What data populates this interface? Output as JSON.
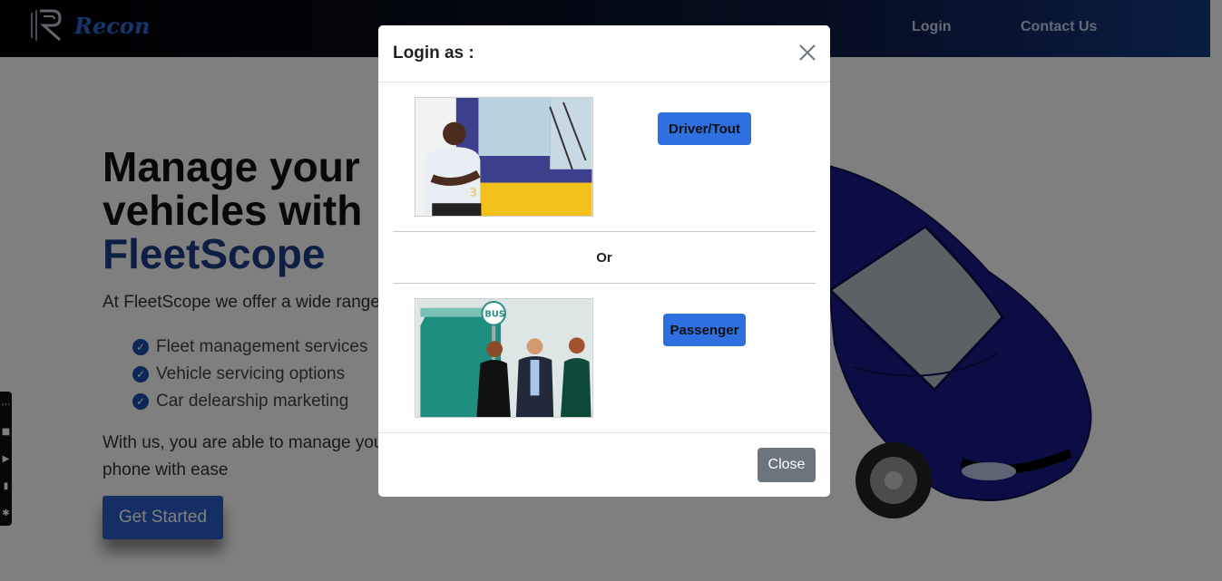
{
  "nav": {
    "brand": "Recon",
    "links": [
      {
        "label": "Login"
      },
      {
        "label": "Contact Us"
      }
    ]
  },
  "hero": {
    "title_line1": "Manage your",
    "title_line2": "vehicles with",
    "title_brand": "FleetScope",
    "subtitle": "At FleetScope we offer a wide range",
    "features": [
      "Fleet management services",
      "Vehicle servicing options",
      "Car delearship marketing"
    ],
    "body_line1": "With us, you are able to manage you",
    "body_line2": "phone with ease",
    "cta": "Get Started"
  },
  "modal": {
    "title": "Login as :",
    "driver_button": "Driver/Tout",
    "separator": "Or",
    "passenger_button": "Passenger",
    "bus_sign": "BUS",
    "close_button": "Close"
  },
  "colors": {
    "accent": "#2f6fe0",
    "brand_blue": "#1e3f86",
    "car": "#1a1a8c",
    "close_button": "#6c757d"
  }
}
